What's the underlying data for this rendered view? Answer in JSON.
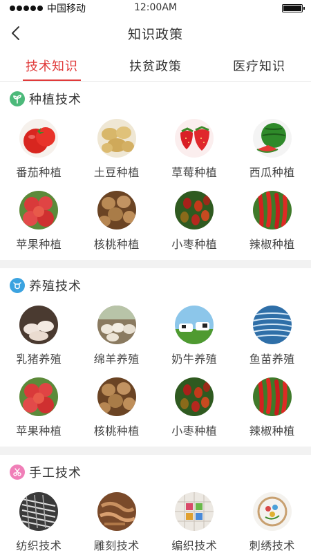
{
  "status": {
    "carrier": "中国移动",
    "time": "12:00AM"
  },
  "nav": {
    "title": "知识政策"
  },
  "tabs": [
    {
      "label": "技术知识",
      "active": true
    },
    {
      "label": "扶贫政策",
      "active": false
    },
    {
      "label": "医疗知识",
      "active": false
    }
  ],
  "sections": [
    {
      "title": "种植技术",
      "icon": "sprout-icon",
      "color": "#4cb97a",
      "items": [
        {
          "label": "番茄种植",
          "icon": "tomato"
        },
        {
          "label": "土豆种植",
          "icon": "potato"
        },
        {
          "label": "草莓种植",
          "icon": "strawberry"
        },
        {
          "label": "西瓜种植",
          "icon": "watermelon"
        },
        {
          "label": "苹果种植",
          "icon": "apple"
        },
        {
          "label": "核桃种植",
          "icon": "walnut"
        },
        {
          "label": "小枣种植",
          "icon": "jujube"
        },
        {
          "label": "辣椒种植",
          "icon": "chili"
        }
      ]
    },
    {
      "title": "养殖技术",
      "icon": "cow-icon",
      "color": "#3ba3e0",
      "items": [
        {
          "label": "乳猪养殖",
          "icon": "piglet"
        },
        {
          "label": "绵羊养殖",
          "icon": "sheep"
        },
        {
          "label": "奶牛养殖",
          "icon": "cow"
        },
        {
          "label": "鱼苗养殖",
          "icon": "fish"
        },
        {
          "label": "苹果种植",
          "icon": "apple"
        },
        {
          "label": "核桃种植",
          "icon": "walnut"
        },
        {
          "label": "小枣种植",
          "icon": "jujube"
        },
        {
          "label": "辣椒种植",
          "icon": "chili"
        }
      ]
    },
    {
      "title": "手工技术",
      "icon": "scissors-icon",
      "color": "#f07fb8",
      "items": [
        {
          "label": "纺织技术",
          "icon": "loom"
        },
        {
          "label": "雕刻技术",
          "icon": "carving"
        },
        {
          "label": "编织技术",
          "icon": "knitting"
        },
        {
          "label": "刺绣技术",
          "icon": "embroidery"
        }
      ]
    }
  ],
  "colors": {
    "accent": "#e03a3a",
    "divider": "#f2f2f2"
  }
}
